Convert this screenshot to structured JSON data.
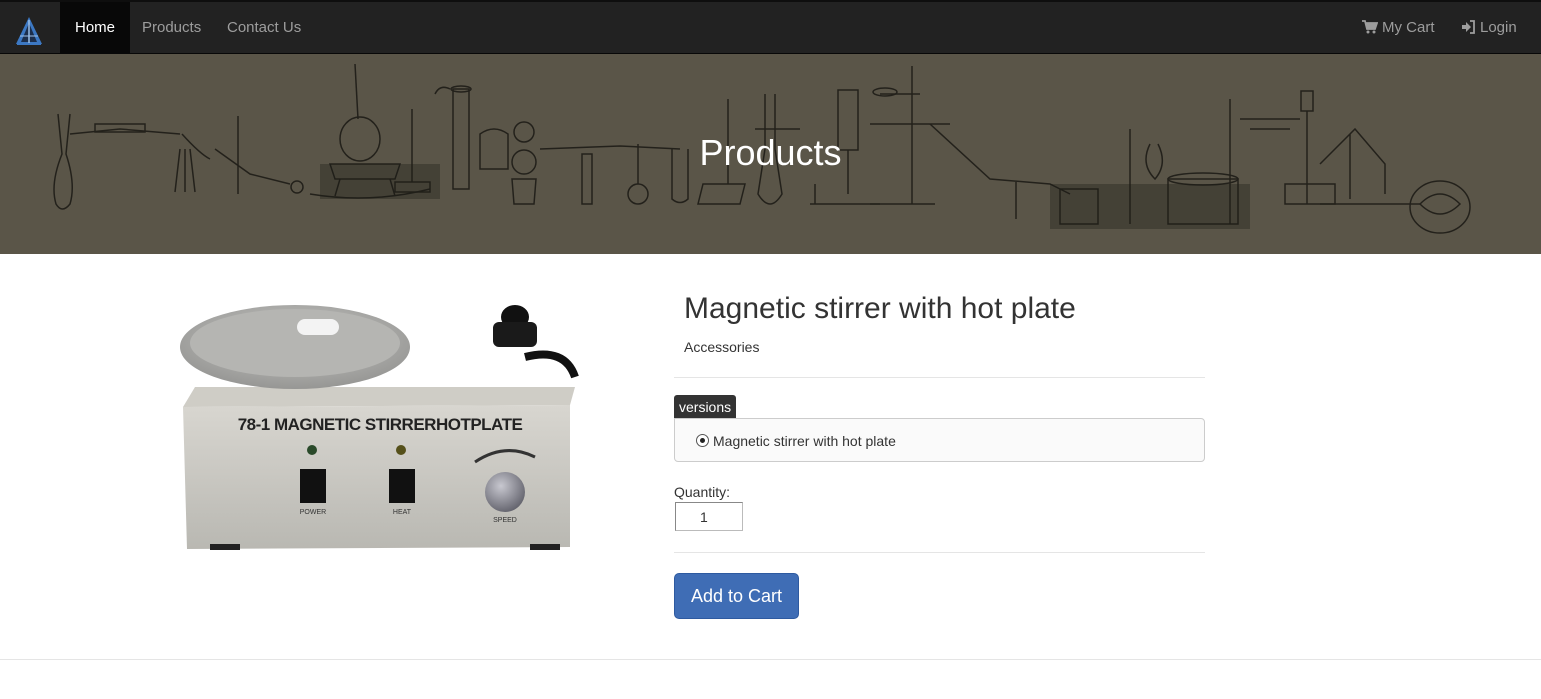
{
  "nav": {
    "items": [
      {
        "label": "Home",
        "active": true
      },
      {
        "label": "Products",
        "active": false
      },
      {
        "label": "Contact Us",
        "active": false
      }
    ],
    "cart_label": "My Cart",
    "login_label": "Login",
    "brand_icon": "triangle-logo-icon",
    "cart_icon": "shopping-cart-icon",
    "login_icon": "sign-in-icon"
  },
  "hero": {
    "title": "Products",
    "background_color": "#5a5548"
  },
  "product": {
    "image_alt_text": "78-1 MAGNETIC STIRRERHOTPLATE",
    "image_labels": [
      "POWER",
      "HEAT",
      "SPEED"
    ],
    "title": "Magnetic stirrer with hot plate",
    "category": "Accessories",
    "versions_label": "versions",
    "versions": [
      {
        "label": "Magnetic stirrer with hot plate",
        "selected": true
      }
    ],
    "quantity_label": "Quantity:",
    "quantity_value": "1",
    "add_to_cart_label": "Add to Cart"
  },
  "colors": {
    "navbar": "#222222",
    "accent_button": "#3f6db5"
  }
}
